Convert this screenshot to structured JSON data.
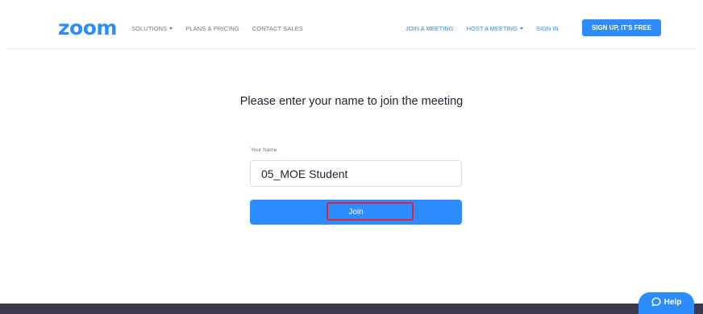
{
  "header": {
    "logo_text": "zoom",
    "nav_left": [
      {
        "label": "SOLUTIONS",
        "has_dropdown": true
      },
      {
        "label": "PLANS & PRICING",
        "has_dropdown": false
      },
      {
        "label": "CONTACT SALES",
        "has_dropdown": false
      }
    ],
    "nav_right": [
      {
        "label": "JOIN A MEETING",
        "has_dropdown": false
      },
      {
        "label": "HOST A MEETING",
        "has_dropdown": true
      },
      {
        "label": "SIGN IN",
        "has_dropdown": false
      }
    ],
    "signup_label": "SIGN UP, IT'S FREE"
  },
  "main": {
    "prompt": "Please enter your name to join the meeting",
    "name_label": "Your Name",
    "name_value": "05_MOE Student",
    "join_label": "Join"
  },
  "help": {
    "label": "Help",
    "icon": "chat-bubble-icon"
  },
  "colors": {
    "brand_blue": "#2d8cff",
    "highlight_red": "#e0233a",
    "footer_dark": "#3a3a4b"
  }
}
